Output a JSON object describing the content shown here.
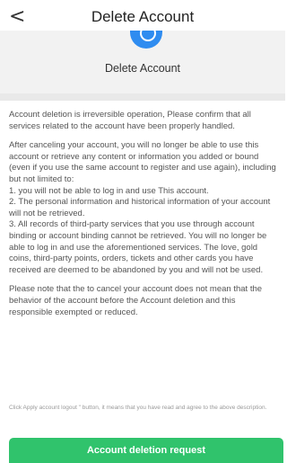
{
  "nav": {
    "back_icon": "<",
    "title": "Delete Account"
  },
  "header": {
    "title": "Delete Account",
    "icon": "blue-account-icon"
  },
  "content": {
    "para1": "Account deletion is irreversible operation, Please confirm that all services related to the account have been properly handled.",
    "para2_lines": [
      "After canceling your account, you will no longer be able to use this account or retrieve any content or information you added or bound (even if you use the same account to register and use again), including but not limited to:",
      "1. you will not be able to log in and use This account.",
      "2. The personal information and historical information of your account will not be retrieved.",
      "3. All records of third-party services that you use through account binding or account binding cannot be retrieved. You will no longer be able to log in and use the aforementioned services. The love, gold coins, third-party points, orders, tickets and other cards you have received are deemed to be abandoned by you and will not be used."
    ],
    "para3": "Please note that the to cancel your account does not mean that the behavior of the account before the Account deletion and this responsible exempted or reduced."
  },
  "agree_text": "Click  Apply account logout \" button, it means that you have read and agree to the above description.",
  "button_label": "Account deletion request",
  "colors": {
    "accent": "#30c36c",
    "icon_blue": "#2f8cf0"
  }
}
